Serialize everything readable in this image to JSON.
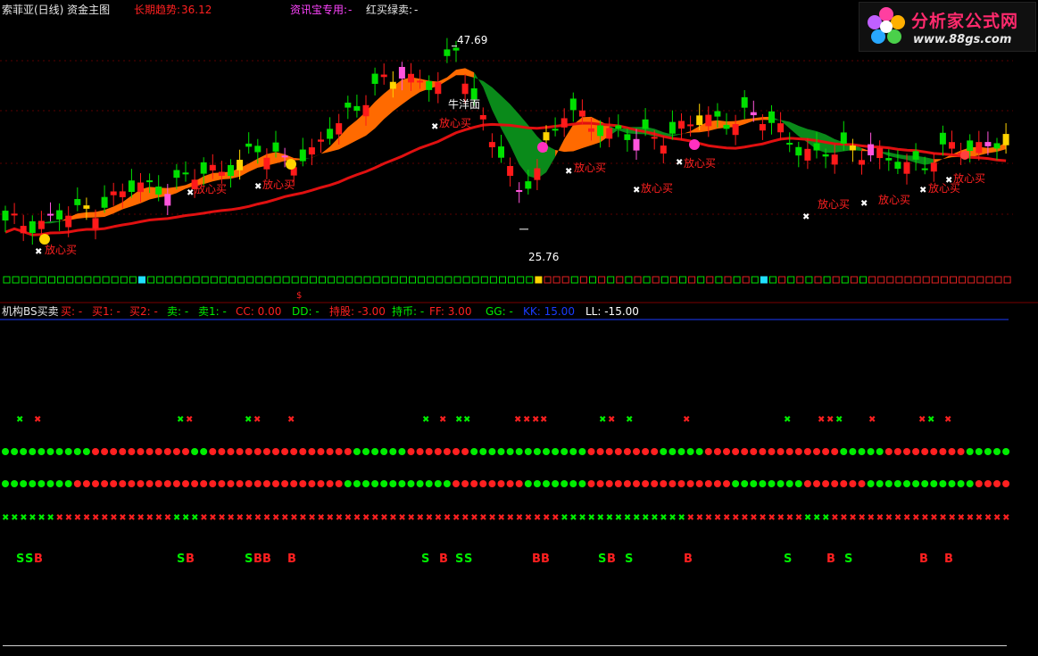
{
  "title_bar": {
    "name": "索菲亚(日线) 资金主图",
    "long_trend_label": "长期趋势:",
    "long_trend_value": "36.12",
    "zixunbao_label": "资讯宝专用:",
    "zixunbao_value": "-",
    "hongmai_label": "红买绿卖:",
    "hongmai_value": "-"
  },
  "logo": {
    "cn": "分析家公式网",
    "url": "www.88gs.com"
  },
  "annotations": {
    "high_price": "47.69",
    "low_price": "25.76",
    "niu_yang_mian": "牛洋面",
    "buy_sign": "放心买",
    "dollar_marker": "$"
  },
  "lower_panel": {
    "name": "机构BS买卖",
    "fields": [
      {
        "label": "买:",
        "value": "-",
        "color": "#ff2020"
      },
      {
        "label": "买1:",
        "value": "-",
        "color": "#ff2020"
      },
      {
        "label": "买2:",
        "value": "-",
        "color": "#ff2020"
      },
      {
        "label": "卖:",
        "value": "-",
        "color": "#00ee00"
      },
      {
        "label": "卖1:",
        "value": "-",
        "color": "#00ee00"
      },
      {
        "label": "CC:",
        "value": "0.00",
        "color": "#ff2020"
      },
      {
        "label": "DD:",
        "value": "-",
        "color": "#00ee00"
      },
      {
        "label": "持股:",
        "value": "-3.00",
        "color": "#ff2020"
      },
      {
        "label": "持币:",
        "value": "-",
        "color": "#00ee00"
      },
      {
        "label": "FF:",
        "value": "3.00",
        "color": "#ff2020"
      },
      {
        "label": "GG:",
        "value": "-",
        "color": "#00ee00"
      },
      {
        "label": "KK:",
        "value": "15.00",
        "color": "#1a3cff"
      },
      {
        "label": "LL:",
        "value": "-15.00",
        "color": "#ffffff"
      }
    ]
  },
  "chart_data": {
    "type": "candlestick",
    "ylim": [
      22,
      50
    ],
    "high_label": 47.69,
    "low_label": 25.76,
    "long_trend": 36.12,
    "bs_letters": [
      {
        "t": "S",
        "c": "g"
      },
      {
        "t": "S",
        "c": "g"
      },
      {
        "t": "B",
        "c": "r"
      },
      {
        "t": "S",
        "c": "g"
      },
      {
        "t": "B",
        "c": "r"
      },
      {
        "t": "S",
        "c": "g"
      },
      {
        "t": "B",
        "c": "r"
      },
      {
        "t": "B",
        "c": "r"
      },
      {
        "t": "B",
        "c": "r"
      },
      {
        "t": "S",
        "c": "g"
      },
      {
        "t": "B",
        "c": "r"
      },
      {
        "t": "S",
        "c": "g"
      },
      {
        "t": "S",
        "c": "g"
      },
      {
        "t": "B",
        "c": "r"
      },
      {
        "t": "B",
        "c": "r"
      },
      {
        "t": "S",
        "c": "g"
      },
      {
        "t": "B",
        "c": "r"
      },
      {
        "t": "S",
        "c": "g"
      },
      {
        "t": "B",
        "c": "r"
      },
      {
        "t": "S",
        "c": "g"
      },
      {
        "t": "B",
        "c": "r"
      },
      {
        "t": "S",
        "c": "g"
      },
      {
        "t": "B",
        "c": "r"
      },
      {
        "t": "B",
        "c": "r"
      }
    ]
  },
  "colors": {
    "up": "#ff1a1a",
    "down": "#00e000",
    "ribbon_orange": "#ff6a00",
    "ribbon_green": "#0a8a1a",
    "trend_line": "#e01010",
    "grid": "#5a0000"
  }
}
